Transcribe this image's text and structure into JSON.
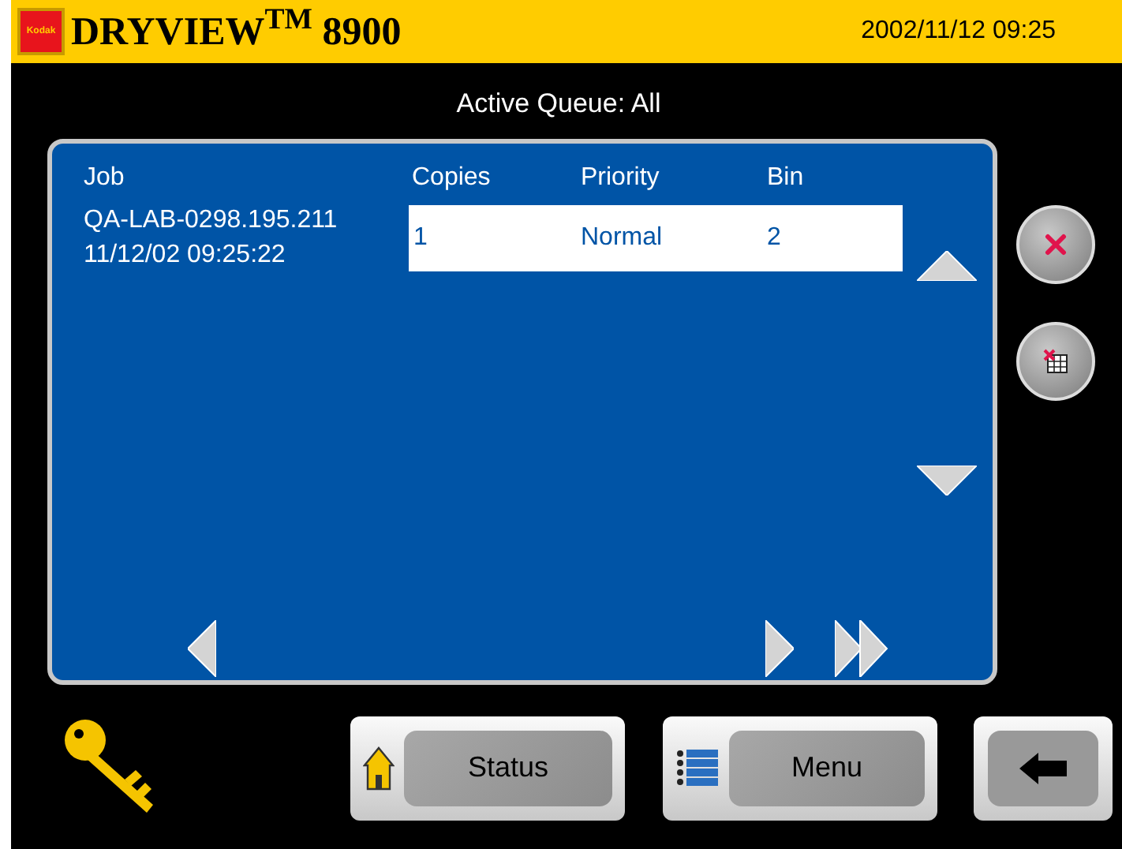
{
  "header": {
    "logo_text": "Kodak",
    "product": "DRYVIEW$^{TM}$ 8900",
    "datetime": "2002/11/12 09:25"
  },
  "queue_title": "Active Queue: All",
  "table": {
    "columns": [
      "Job",
      "Copies",
      "Priority",
      "Bin"
    ],
    "rows": [
      {
        "job": "QA-LAB-0298.195.211",
        "time": "11/12/02 09:25:22",
        "copies": "1",
        "priority": "Normal",
        "bin": "2",
        "selected": true
      }
    ]
  },
  "buttons": [
    {
      "label": "Status",
      "kind": "home"
    },
    {
      "label": "Menu",
      "kind": "menu"
    }
  ]
}
